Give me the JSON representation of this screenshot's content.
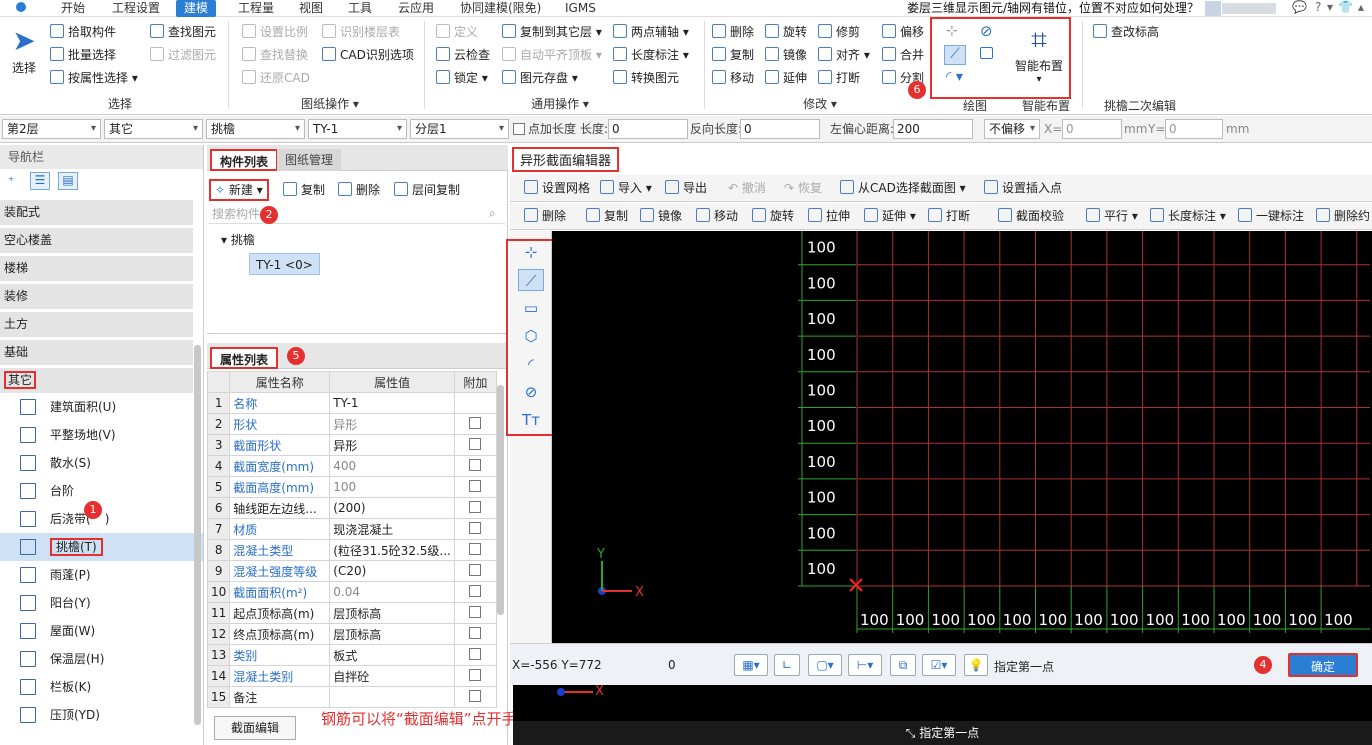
{
  "menubar": {
    "items": [
      "开始",
      "工程设置",
      "建模",
      "工程量",
      "视图",
      "工具",
      "云应用",
      "协同建模(限免)",
      "IGMS"
    ],
    "active": "建模",
    "question": "娄层三维显示图元/轴网有错位，位置不对应如何处理？"
  },
  "ribbon": {
    "select": {
      "label": "选择",
      "pick": "拾取构件",
      "batch": "批量选择",
      "by_attr": "按属性选择",
      "group": "选择"
    },
    "find": {
      "find": "查找图元",
      "filter": "过滤图元"
    },
    "drawing": {
      "scale": "设置比例",
      "find_replace": "查找替换",
      "restore": "还原CAD",
      "recognize_floor": "识别楼层表",
      "cad_options": "CAD识别选项",
      "group": "图纸操作"
    },
    "common": {
      "define": "定义",
      "cloud_check": "云检查",
      "lock": "锁定",
      "copy_to_floor": "复制到其它层",
      "auto_align": "自动平齐顶板",
      "save_elem": "图元存盘",
      "two_point_axis": "两点辅轴",
      "length_dim": "长度标注",
      "convert": "转换图元",
      "group": "通用操作"
    },
    "modify": {
      "delete": "删除",
      "rotate": "旋转",
      "trim": "修剪",
      "offset": "偏移",
      "copy": "复制",
      "mirror": "镜像",
      "align": "对齐",
      "merge": "合并",
      "move": "移动",
      "extend": "延伸",
      "break": "打断",
      "split": "分割",
      "group": "修改"
    },
    "draw": {
      "group": "绘图"
    },
    "smart": {
      "label": "智能布置",
      "group": "智能布置"
    },
    "cantilever": {
      "modify_elev": "查改标高",
      "group": "挑檐二次编辑"
    }
  },
  "propbar": {
    "floor": "第2层",
    "category": "其它",
    "type": "挑檐",
    "item": "TY-1",
    "layer": "分层1",
    "add_length_label": "点加长度",
    "length_label": "长度:",
    "length_val": "0",
    "rev_length_label": "反向长度:",
    "rev_length_val": "0",
    "left_offset_label": "左偏心距离:",
    "left_offset_val": "200",
    "offset_mode": "不偏移",
    "x_label": "X=",
    "x_val": "0",
    "y_label": "Y=",
    "y_val": "0",
    "mm": "mm"
  },
  "nav": {
    "title": "导航栏",
    "categories": [
      "装配式",
      "空心楼盖",
      "楼梯",
      "装修",
      "土方",
      "基础",
      "其它"
    ],
    "items": [
      "建筑面积(U)",
      "平整场地(V)",
      "散水(S)",
      "台阶",
      "后浇带(",
      "挑檐(T)",
      "雨蓬(P)",
      "阳台(Y)",
      "屋面(W)",
      "保温层(H)",
      "栏板(K)",
      "压顶(YD)"
    ]
  },
  "component": {
    "tab_list": "构件列表",
    "tab_drawing": "图纸管理",
    "new": "新建",
    "copy": "复制",
    "delete": "删除",
    "floor_copy": "层间复制",
    "search_placeholder": "搜索构件...",
    "tree_root": "挑檐",
    "tree_item": "TY-1 <0>",
    "prop_tab": "属性列表",
    "headers": [
      "属性名称",
      "属性值",
      "附加"
    ],
    "rows": [
      {
        "n": "1",
        "name": "名称",
        "val": "TY-1",
        "blue": true,
        "gray": false,
        "chk": false
      },
      {
        "n": "2",
        "name": "形状",
        "val": "异形",
        "blue": true,
        "gray": true,
        "chk": true
      },
      {
        "n": "3",
        "name": "截面形状",
        "val": "异形",
        "blue": true,
        "gray": false,
        "chk": true
      },
      {
        "n": "4",
        "name": "截面宽度(mm)",
        "val": "400",
        "blue": true,
        "gray": true,
        "chk": true
      },
      {
        "n": "5",
        "name": "截面高度(mm)",
        "val": "100",
        "blue": true,
        "gray": true,
        "chk": true
      },
      {
        "n": "6",
        "name": "轴线距左边线...",
        "val": "(200)",
        "blue": false,
        "gray": false,
        "chk": true
      },
      {
        "n": "7",
        "name": "材质",
        "val": "现浇混凝土",
        "blue": true,
        "gray": false,
        "chk": true
      },
      {
        "n": "8",
        "name": "混凝土类型",
        "val": "(粒径31.5砼32.5级...",
        "blue": true,
        "gray": false,
        "chk": true
      },
      {
        "n": "9",
        "name": "混凝土强度等级",
        "val": "(C20)",
        "blue": true,
        "gray": false,
        "chk": true
      },
      {
        "n": "10",
        "name": "截面面积(m²)",
        "val": "0.04",
        "blue": true,
        "gray": true,
        "chk": true
      },
      {
        "n": "11",
        "name": "起点顶标高(m)",
        "val": "层顶标高",
        "blue": false,
        "gray": false,
        "chk": true
      },
      {
        "n": "12",
        "name": "终点顶标高(m)",
        "val": "层顶标高",
        "blue": false,
        "gray": false,
        "chk": true
      },
      {
        "n": "13",
        "name": "类别",
        "val": "板式",
        "blue": true,
        "gray": false,
        "chk": true
      },
      {
        "n": "14",
        "name": "混凝土类别",
        "val": "自拌砼",
        "blue": true,
        "gray": false,
        "chk": true
      },
      {
        "n": "15",
        "name": "备注",
        "val": "",
        "blue": false,
        "gray": false,
        "chk": true
      }
    ],
    "section_edit": "截面编辑"
  },
  "editor": {
    "title": "异形截面编辑器",
    "tb1": {
      "grid": "设置网格",
      "import": "导入",
      "export": "导出",
      "undo": "撤消",
      "redo": "恢复",
      "from_cad": "从CAD选择截面图",
      "insert_point": "设置插入点"
    },
    "tb2": {
      "delete": "删除",
      "copy": "复制",
      "mirror": "镜像",
      "move": "移动",
      "rotate": "旋转",
      "stretch": "拉伸",
      "extend": "延伸",
      "break": "打断",
      "check": "截面校验",
      "parallel": "平行",
      "length_dim": "长度标注",
      "one_key": "一键标注",
      "delete_cons": "删除约"
    },
    "grid_label": "100",
    "coords": "X=-556 Y=772",
    "zero": "0",
    "hint": "指定第一点",
    "ok": "确定",
    "axis_x": "X",
    "axis_y": "Y"
  },
  "bottom_hint": "指定第一点",
  "annotation": "钢筋可以将“截面编辑”点开手动绘制钢筋。",
  "badges": [
    "1",
    "2",
    "3",
    "4",
    "5",
    "6"
  ]
}
